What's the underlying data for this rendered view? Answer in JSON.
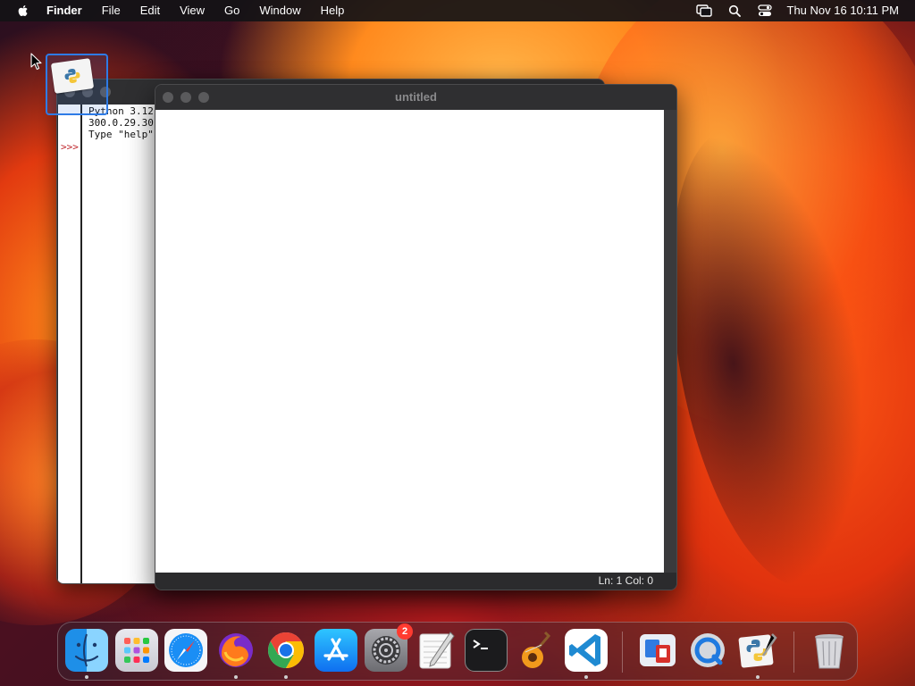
{
  "menubar": {
    "app_name": "Finder",
    "items": [
      "File",
      "Edit",
      "View",
      "Go",
      "Window",
      "Help"
    ],
    "clock": "Thu Nov 16  10:11 PM"
  },
  "shell_window": {
    "lines": [
      "Python 3.12",
      "300.0.29.30",
      "Type \"help\""
    ],
    "prompt": ">>>"
  },
  "editor_window": {
    "title": "untitled",
    "status": "Ln: 1   Col: 0"
  },
  "dock": {
    "items": [
      {
        "name": "finder",
        "running": true
      },
      {
        "name": "launchpad",
        "running": false
      },
      {
        "name": "safari",
        "running": false
      },
      {
        "name": "firefox",
        "running": true
      },
      {
        "name": "chrome",
        "running": true
      },
      {
        "name": "app-store",
        "running": false
      },
      {
        "name": "system-settings",
        "running": false,
        "badge": "2"
      },
      {
        "name": "textedit",
        "running": false
      },
      {
        "name": "terminal",
        "running": false
      },
      {
        "name": "garageband",
        "running": false
      },
      {
        "name": "vscode",
        "running": true
      },
      {
        "name": "remote-desktop",
        "running": false
      },
      {
        "name": "quicktime",
        "running": false
      },
      {
        "name": "python-launcher",
        "running": true
      },
      {
        "name": "trash",
        "running": false
      }
    ]
  },
  "colors": {
    "selection": "#2e7be6",
    "prompt": "#c0272d",
    "badge": "#ff3b30"
  }
}
